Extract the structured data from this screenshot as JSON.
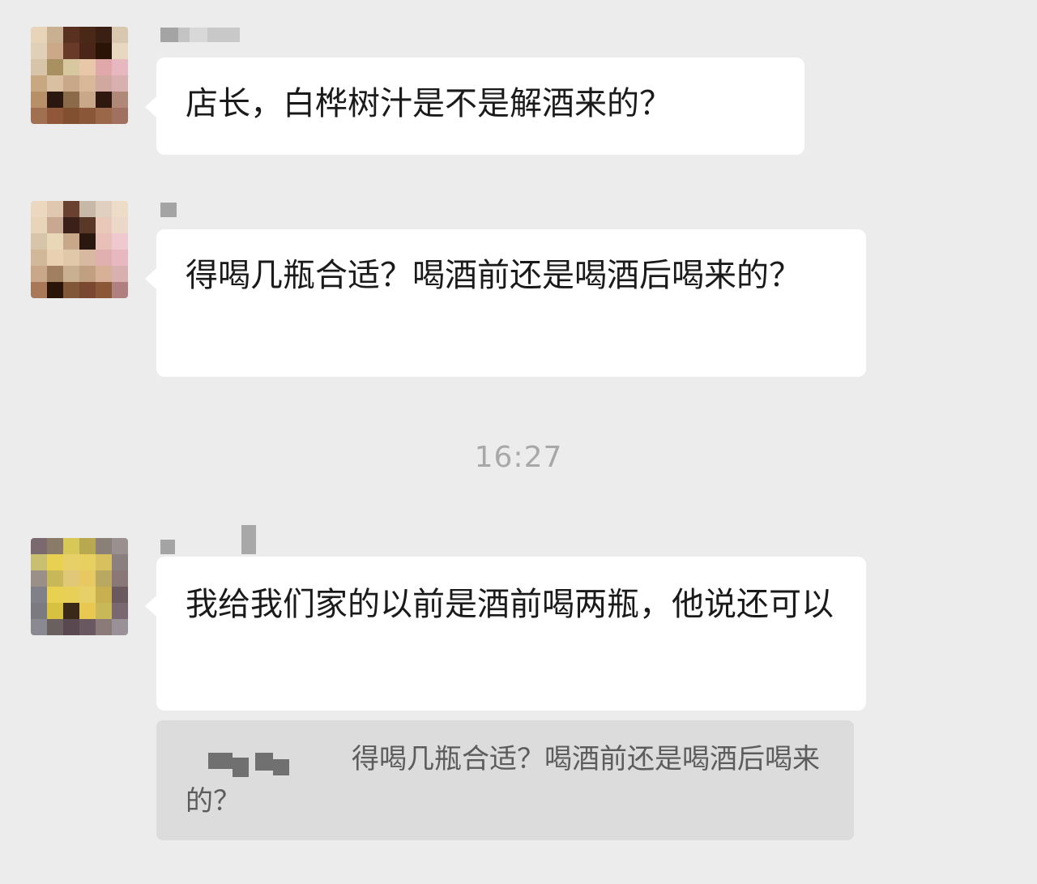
{
  "messages": [
    {
      "text": "店长，白桦树汁是不是解酒来的？"
    },
    {
      "text": "得喝几瓶合适？喝酒前还是喝酒后喝来的？"
    },
    {
      "text": "我给我们家的以前是酒前喝两瓶，他说还可以"
    }
  ],
  "timestamp": "16:27",
  "quote": {
    "text": "得喝几瓶合适？喝酒前还是喝酒后喝来的？"
  }
}
